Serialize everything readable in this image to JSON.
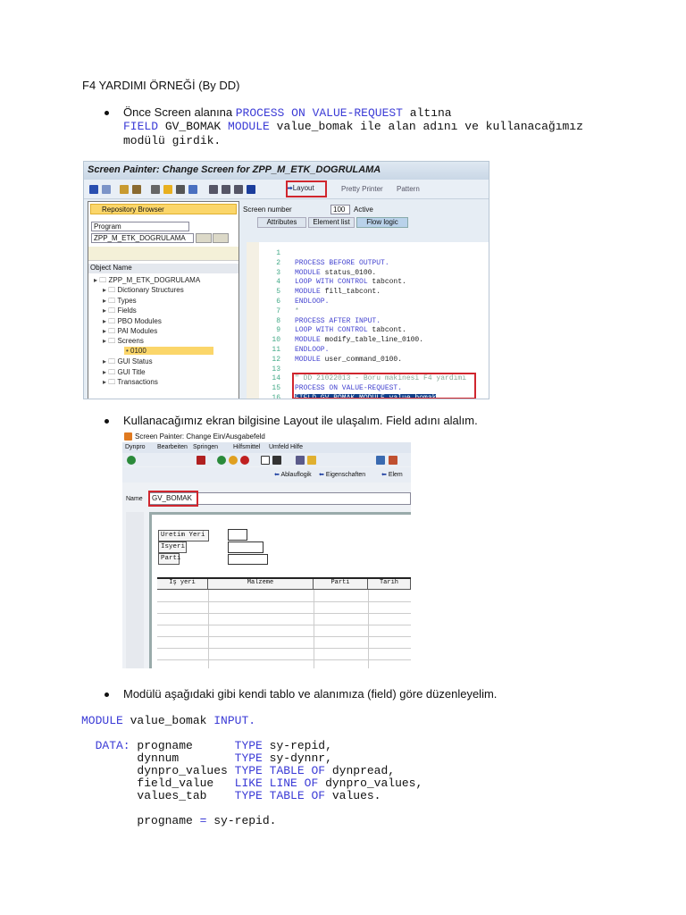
{
  "title": "F4 YARDIMI ÖRNEĞİ (By DD)",
  "bullet1": {
    "text_before": "Önce Screen alanına ",
    "kw1": "PROCESS ON VALUE-REQUEST",
    "text_after": " altına",
    "line2": [
      {
        "t": "FIELD",
        "k": 1
      },
      {
        "t": " GV_BOMAK ",
        "k": 0
      },
      {
        "t": "MODULE",
        "k": 1
      },
      {
        "t": " value_bomak ile alan adını ve kullanacağımız",
        "k": 0
      }
    ],
    "line3": "modülü girdik."
  },
  "shot1": {
    "title": "Screen Painter: Change Screen for ZPP_M_ETK_DOGRULAMA",
    "toolbar": {
      "layout": "Layout",
      "pretty_printer": "Pretty Printer",
      "pattern": "Pattern"
    },
    "repo_browser": "Repository Browser",
    "type_select": "Program",
    "program": "ZPP_M_ETK_DOGRULAMA",
    "object_name": "Object Name",
    "tree": [
      "ZPP_M_ETK_DOGRULAMA",
      "Dictionary Structures",
      "Types",
      "Fields",
      "PBO Modules",
      "PAI Modules",
      "Screens",
      "0100",
      "GUI Status",
      "GUI Title",
      "Transactions"
    ],
    "screen_number_label": "Screen number",
    "screen_number": "100",
    "status": "Active",
    "tabs": [
      "Attributes",
      "Element list",
      "Flow logic"
    ],
    "code": [
      [],
      [
        {
          "t": "PROCESS BEFORE OUTPUT.",
          "k": 1
        }
      ],
      [
        {
          "t": "  MODULE",
          "k": 1
        },
        {
          "t": " status_0100.",
          "k": 0
        }
      ],
      [
        {
          "t": "  LOOP WITH CONTROL",
          "k": 1
        },
        {
          "t": " tabcont.",
          "k": 0
        }
      ],
      [
        {
          "t": "    MODULE",
          "k": 1
        },
        {
          "t": " fill_tabcont.",
          "k": 0
        }
      ],
      [
        {
          "t": "  ENDLOOP.",
          "k": 1
        }
      ],
      [
        {
          "t": "*",
          "k": 2
        }
      ],
      [
        {
          "t": "PROCESS AFTER INPUT.",
          "k": 1
        }
      ],
      [
        {
          "t": "  LOOP WITH CONTROL",
          "k": 1
        },
        {
          "t": " tabcont.",
          "k": 0
        }
      ],
      [
        {
          "t": "    MODULE",
          "k": 1
        },
        {
          "t": " modify_table_line_0100.",
          "k": 0
        }
      ],
      [
        {
          "t": "  ENDLOOP.",
          "k": 1
        }
      ],
      [
        {
          "t": "  MODULE",
          "k": 1
        },
        {
          "t": " user_command_0100.",
          "k": 0
        }
      ],
      [],
      [
        {
          "t": "\" DD 21022013 - Boru makinesi F4 yardımı",
          "k": 2
        }
      ],
      [
        {
          "t": "PROCESS ON VALUE-REQUEST.",
          "k": 1
        }
      ],
      [
        {
          "t": "  FIELD GV_BOMAK MODULE value_bomak",
          "k": 3
        },
        {
          "t": ".",
          "k": 0
        }
      ]
    ]
  },
  "bullet2": "Kullanacağımız ekran bilgisine Layout ile ulaşalım. Field adını alalım.",
  "shot2": {
    "title": "Screen Painter: Change Ein/Ausgabefeld",
    "menu": [
      "Dynpro",
      "Bearbeiten",
      "Springen",
      "Hilfsmittel",
      "Umfeld",
      "Hilfe"
    ],
    "toolbar2": [
      "Ablauflogik",
      "Eigenschaften",
      "Elem"
    ],
    "name_label": "Name",
    "name_value": "GV_BOMAK",
    "labels": [
      "Uretim Yeri",
      "Isyeri",
      "Parti"
    ],
    "columns": [
      "Iş yeri",
      "Malzeme",
      "Parti",
      "Tarih"
    ]
  },
  "bullet3": "Modülü aşağıdaki gibi kendi tablo ve alanımıza (field) göre düzenleyelim.",
  "code": [
    [
      {
        "t": "MODULE",
        "k": 1
      },
      {
        "t": " value_bomak ",
        "k": 0
      },
      {
        "t": "INPUT.",
        "k": 1
      }
    ],
    [],
    [
      {
        "t": "  DATA:",
        "k": 1
      },
      {
        "t": " progname      ",
        "k": 0
      },
      {
        "t": "TYPE",
        "k": 1
      },
      {
        "t": " sy-repid,",
        "k": 0
      }
    ],
    [
      {
        "t": "        dynnum        ",
        "k": 0
      },
      {
        "t": "TYPE",
        "k": 1
      },
      {
        "t": " sy-dynnr,",
        "k": 0
      }
    ],
    [
      {
        "t": "        dynpro_values ",
        "k": 0
      },
      {
        "t": "TYPE TABLE OF",
        "k": 1
      },
      {
        "t": " dynpread,",
        "k": 0
      }
    ],
    [
      {
        "t": "        field_value   ",
        "k": 0
      },
      {
        "t": "LIKE LINE OF",
        "k": 1
      },
      {
        "t": " dynpro_values,",
        "k": 0
      }
    ],
    [
      {
        "t": "        values_tab    ",
        "k": 0
      },
      {
        "t": "TYPE TABLE OF",
        "k": 1
      },
      {
        "t": " values.",
        "k": 0
      }
    ],
    [],
    [
      {
        "t": "        progname ",
        "k": 0
      },
      {
        "t": "=",
        "k": 1
      },
      {
        "t": " sy-repid.",
        "k": 0
      }
    ]
  ],
  "colors": {
    "keyword": "#3b3bd6",
    "highlight": "#d0262e"
  }
}
